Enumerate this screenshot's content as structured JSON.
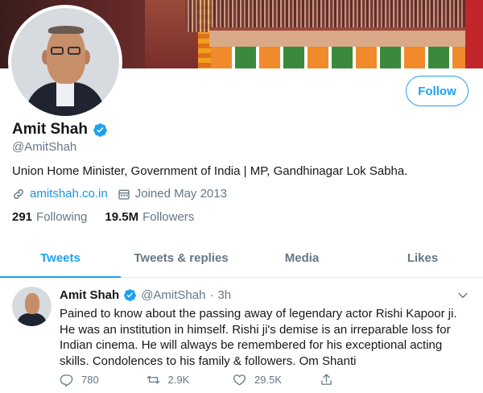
{
  "profile": {
    "display_name": "Amit Shah",
    "handle": "@AmitShah",
    "bio": "Union Home Minister, Government of India | MP, Gandhinagar Lok Sabha.",
    "website": "amitshah.co.in",
    "joined": "Joined May 2013",
    "follow_label": "Follow",
    "following_count": "291",
    "following_label": "Following",
    "followers_count": "19.5M",
    "followers_label": "Followers"
  },
  "tabs": [
    {
      "label": "Tweets",
      "active": true
    },
    {
      "label": "Tweets & replies",
      "active": false
    },
    {
      "label": "Media",
      "active": false
    },
    {
      "label": "Likes",
      "active": false
    }
  ],
  "tweet": {
    "name": "Amit Shah",
    "handle": "@AmitShah",
    "separator": "·",
    "time": "3h",
    "lines": [
      "Pained to know about the passing away of legendary actor Rishi Kapoor ji.",
      "He was an institution in himself. Rishi ji's demise is an irreparable loss for",
      "Indian cinema. He will always be remembered for his exceptional acting",
      "skills. Condolences to his family & followers. Om Shanti"
    ],
    "replies": "780",
    "retweets": "2.9K",
    "likes": "29.5K"
  },
  "colors": {
    "accent": "#1da1f2",
    "link": "#1b95e0",
    "secondary_text": "#657786"
  }
}
